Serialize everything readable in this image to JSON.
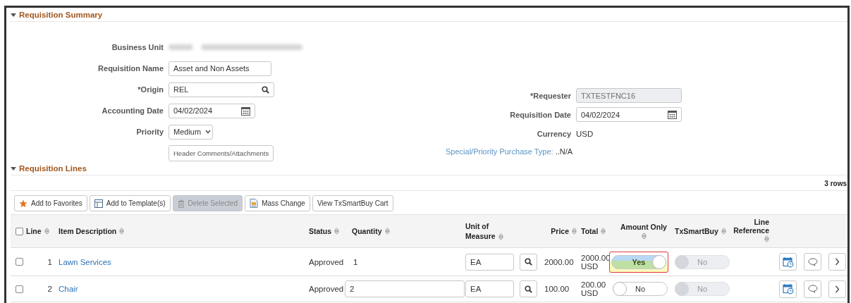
{
  "summary": {
    "title": "Requisition Summary",
    "expanded": true,
    "left_fields": [
      {
        "label": "Business Unit",
        "kind": "redacted"
      },
      {
        "label": "Requisition Name",
        "kind": "text",
        "value": "Asset and Non Assets"
      },
      {
        "label": "*Origin",
        "kind": "lookup",
        "value": "REL"
      },
      {
        "label": "Accounting Date",
        "kind": "date",
        "value": "04/02/2024"
      },
      {
        "label": "Priority",
        "kind": "select",
        "value": "Medium"
      },
      {
        "kind": "button",
        "value": "Header Comments/Attachments"
      }
    ],
    "right_fields": [
      {
        "label": "*Requester",
        "kind": "readonly",
        "value": "TXTESTFNC16"
      },
      {
        "label": "Requisition Date",
        "kind": "date",
        "value": "04/02/2024"
      },
      {
        "label": "Currency",
        "kind": "plain",
        "value": "USD"
      }
    ],
    "special": {
      "link": "Special/Priority Purchase Type:",
      "value": "..N/A"
    }
  },
  "lines": {
    "title": "Requisition Lines",
    "expanded": true,
    "row_count": "3 rows",
    "toolbar": [
      {
        "label": "Add to Favorites",
        "disabled": false
      },
      {
        "label": "Add to Template(s)",
        "disabled": false
      },
      {
        "label": "Delete Selected",
        "disabled": true
      },
      {
        "label": "Mass Change",
        "disabled": false
      },
      {
        "label": "View TxSmartBuy Cart",
        "disabled": false
      }
    ],
    "all_checked": false,
    "columns": [
      {
        "label": "Line",
        "sortable": true
      },
      {
        "label": "Item Description",
        "sortable": true
      },
      {
        "label": "Status",
        "sortable": true
      },
      {
        "label": "Quantity",
        "sortable": true
      },
      {
        "label": "Unit of Measure",
        "sortable": true
      },
      {
        "label": "Price",
        "sortable": true
      },
      {
        "label": "Total",
        "sortable": true
      },
      {
        "label": "Amount Only",
        "sortable": true
      },
      {
        "label": "TxSmartBuy",
        "sortable": true
      },
      {
        "label": "Line Reference",
        "sortable": true
      }
    ],
    "rows": [
      {
        "checked": false,
        "line": "1",
        "item": "Lawn Services",
        "status": "Approved",
        "quantity": {
          "kind": "plain",
          "value": "1"
        },
        "uom": "EA",
        "price": "2000.00",
        "total": [
          "2000.00",
          "USD"
        ],
        "amount_only": {
          "on": true,
          "label": "Yes",
          "marked": true
        },
        "txsmartbuy": {
          "on": false,
          "label": "No",
          "disabled": true
        }
      },
      {
        "checked": false,
        "line": "2",
        "item": "Chair",
        "status": "Approved",
        "quantity": {
          "kind": "input",
          "value": "2"
        },
        "uom": "EA",
        "price": "100.00",
        "total": [
          "200.00",
          "USD"
        ],
        "amount_only": {
          "on": false,
          "label": "No",
          "marked": false
        },
        "txsmartbuy": {
          "on": false,
          "label": "No",
          "disabled": true
        }
      }
    ]
  }
}
